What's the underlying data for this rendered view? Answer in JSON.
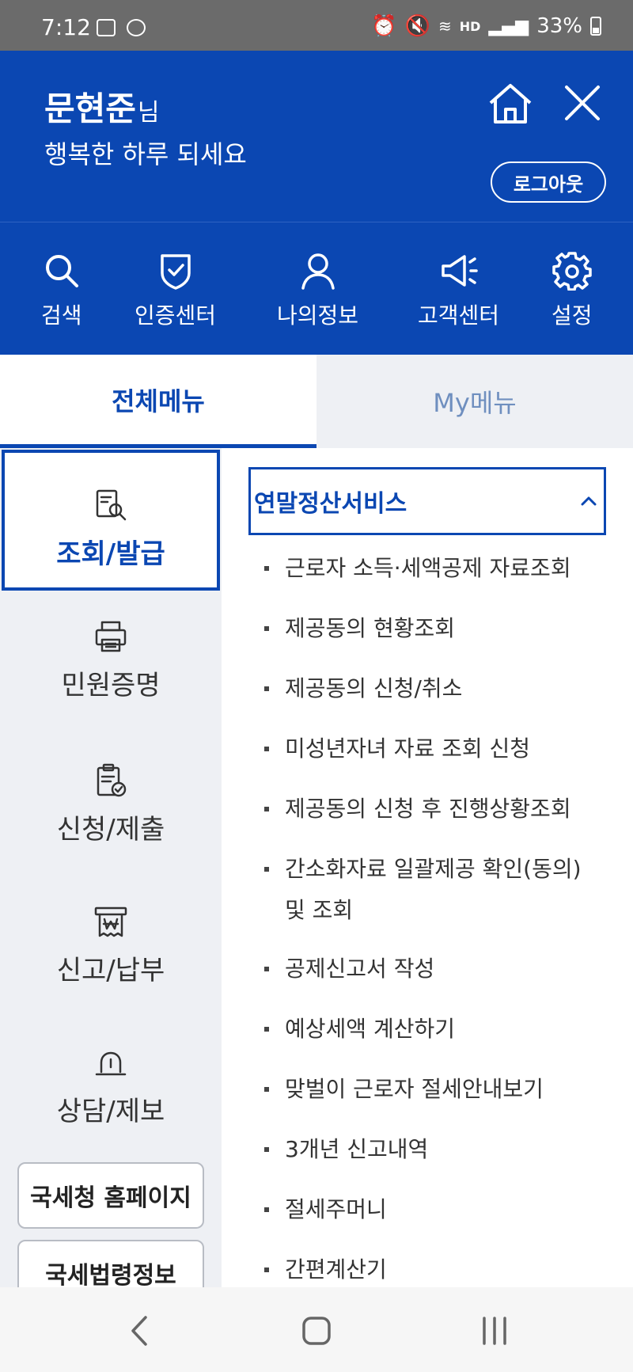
{
  "status_bar": {
    "time": "7:12",
    "battery": "33%",
    "network": "HD"
  },
  "header": {
    "user_name": "문현준",
    "user_suffix": "님",
    "greeting": "행복한 하루 되세요",
    "logout_label": "로그아웃"
  },
  "quick_nav": [
    {
      "label": "검색",
      "icon": "search-icon"
    },
    {
      "label": "인증센터",
      "icon": "shield-check-icon"
    },
    {
      "label": "나의정보",
      "icon": "person-icon"
    },
    {
      "label": "고객센터",
      "icon": "megaphone-icon"
    },
    {
      "label": "설정",
      "icon": "gear-icon"
    }
  ],
  "tabs": [
    {
      "label": "전체메뉴",
      "active": true
    },
    {
      "label": "My메뉴",
      "active": false
    }
  ],
  "categories": [
    {
      "label": "조회/발급",
      "icon": "document-search-icon",
      "active": true
    },
    {
      "label": "민원증명",
      "icon": "printer-icon",
      "active": false
    },
    {
      "label": "신청/제출",
      "icon": "clipboard-check-icon",
      "active": false
    },
    {
      "label": "신고/납부",
      "icon": "receipt-won-icon",
      "active": false
    },
    {
      "label": "상담/제보",
      "icon": "siren-icon",
      "active": false
    }
  ],
  "external_links": [
    {
      "label": "국세청 홈페이지"
    },
    {
      "label": "국세법령정보"
    }
  ],
  "section": {
    "title": "연말정산서비스",
    "expanded": true,
    "items": [
      "근로자 소득·세액공제 자료조회",
      "제공동의 현황조회",
      "제공동의 신청/취소",
      "미성년자녀 자료 조회 신청",
      "제공동의 신청 후 진행상황조회",
      "간소화자료 일괄제공 확인(동의)",
      "및 조회",
      "공제신고서 작성",
      "예상세액 계산하기",
      "맞벌이 근로자 절세안내보기",
      "3개년 신고내역",
      "절세주머니",
      "간편계산기"
    ]
  },
  "colors": {
    "brand_blue": "#0b47b2",
    "panel_gray": "#eef0f4"
  }
}
